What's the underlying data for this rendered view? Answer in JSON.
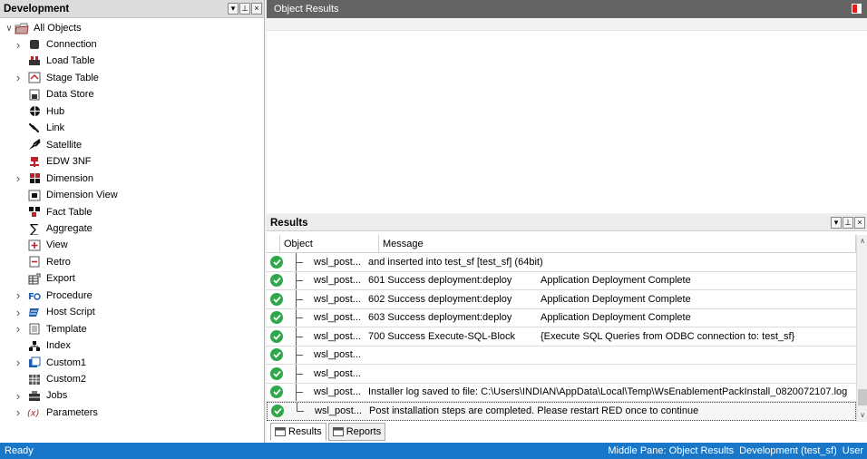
{
  "left_pane": {
    "title": "Development",
    "root_label": "All Objects",
    "items": [
      {
        "label": "Connection",
        "expandable": true,
        "icon": "connection-icon"
      },
      {
        "label": "Load Table",
        "expandable": false,
        "icon": "load-table-icon"
      },
      {
        "label": "Stage Table",
        "expandable": true,
        "icon": "stage-table-icon"
      },
      {
        "label": "Data Store",
        "expandable": false,
        "icon": "data-store-icon"
      },
      {
        "label": "Hub",
        "expandable": false,
        "icon": "hub-icon"
      },
      {
        "label": "Link",
        "expandable": false,
        "icon": "link-icon"
      },
      {
        "label": "Satellite",
        "expandable": false,
        "icon": "satellite-icon"
      },
      {
        "label": "EDW 3NF",
        "expandable": false,
        "icon": "edw-icon"
      },
      {
        "label": "Dimension",
        "expandable": true,
        "icon": "dimension-icon"
      },
      {
        "label": "Dimension View",
        "expandable": false,
        "icon": "dimension-view-icon"
      },
      {
        "label": "Fact Table",
        "expandable": false,
        "icon": "fact-table-icon"
      },
      {
        "label": "Aggregate",
        "expandable": false,
        "icon": "aggregate-icon"
      },
      {
        "label": "View",
        "expandable": false,
        "icon": "view-icon"
      },
      {
        "label": "Retro",
        "expandable": false,
        "icon": "retro-icon"
      },
      {
        "label": "Export",
        "expandable": false,
        "icon": "export-icon"
      },
      {
        "label": "Procedure",
        "expandable": true,
        "icon": "procedure-icon"
      },
      {
        "label": "Host Script",
        "expandable": true,
        "icon": "host-script-icon"
      },
      {
        "label": "Template",
        "expandable": true,
        "icon": "template-icon"
      },
      {
        "label": "Index",
        "expandable": false,
        "icon": "index-icon"
      },
      {
        "label": "Custom1",
        "expandable": true,
        "icon": "custom1-icon"
      },
      {
        "label": "Custom2",
        "expandable": false,
        "icon": "custom2-icon"
      },
      {
        "label": "Jobs",
        "expandable": true,
        "icon": "jobs-icon"
      },
      {
        "label": "Parameters",
        "expandable": true,
        "icon": "parameters-icon"
      }
    ]
  },
  "object_pane": {
    "title": "Object Results"
  },
  "results_pane": {
    "title": "Results",
    "columns": {
      "object": "Object",
      "message": "Message"
    },
    "rows": [
      {
        "object": "wsl_post...",
        "message": "and inserted into test_sf [test_sf] (64bit)",
        "detail": ""
      },
      {
        "object": "wsl_post...",
        "message": "601 Success deployment:deploy",
        "detail": "Application Deployment Complete"
      },
      {
        "object": "wsl_post...",
        "message": "602 Success deployment:deploy",
        "detail": "Application Deployment Complete"
      },
      {
        "object": "wsl_post...",
        "message": "603 Success deployment:deploy",
        "detail": "Application Deployment Complete"
      },
      {
        "object": "wsl_post...",
        "message": "700 Success Execute-SQL-Block",
        "detail": "{Execute SQL Queries from ODBC connection to: test_sf}"
      },
      {
        "object": "wsl_post...",
        "message": "",
        "detail": ""
      },
      {
        "object": "wsl_post...",
        "message": "",
        "detail": ""
      },
      {
        "object": "wsl_post...",
        "message": "Installer log saved to file: C:\\Users\\INDIAN\\AppData\\Local\\Temp\\WsEnablementPackInstall_0820072107.log",
        "detail": ""
      },
      {
        "object": "wsl_post...",
        "message": "Post installation steps are completed. Please restart RED once to continue",
        "detail": ""
      }
    ],
    "tabs": [
      "Results",
      "Reports"
    ]
  },
  "status_bar": {
    "left": "Ready",
    "middle_pane": "Middle Pane: Object Results",
    "environment": "Development (test_sf)",
    "user": "User"
  }
}
